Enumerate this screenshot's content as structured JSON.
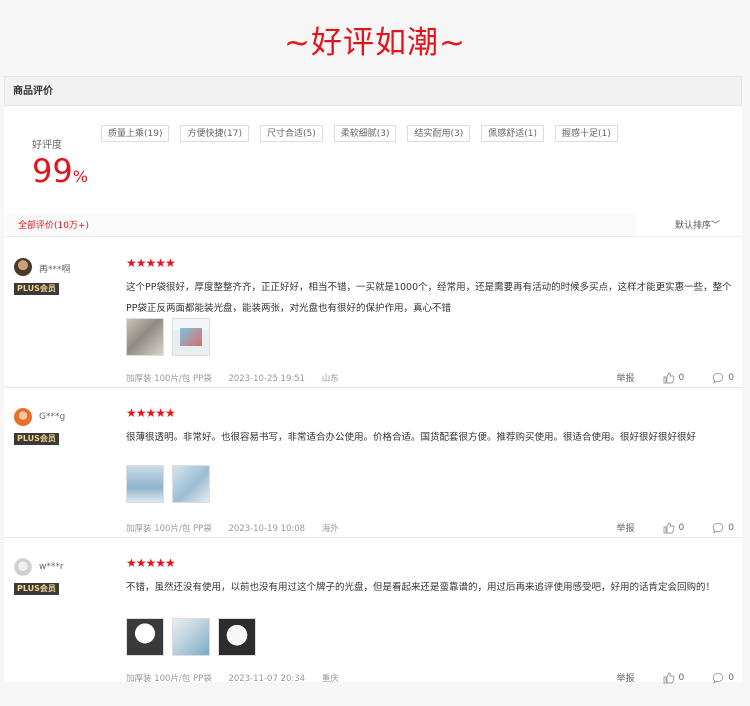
{
  "banner": {
    "title": "~好评如潮~"
  },
  "panel": {
    "title": "商品评价"
  },
  "rating": {
    "label": "好评度",
    "value": "99",
    "unit": "%"
  },
  "tags": [
    "质量上乘(19)",
    "方便快捷(17)",
    "尺寸合适(5)",
    "柔软细腻(3)",
    "结实耐用(3)",
    "佩感舒适(1)",
    "握感十足(1)"
  ],
  "filter": {
    "all_label": "全部评价(10万+)",
    "sort_label": "默认排序﹀"
  },
  "reviews": [
    {
      "user": "再***啊",
      "badge": "PLUS会员",
      "stars": "★★★★★",
      "content": "这个PP袋很好，厚度整整齐齐，正正好好，相当不错，一买就是1000个，经常用，还是需要再有活动的时候多买点，这样才能更实惠一些，整个PP袋正反两面都能装光盘，能装两张，对光盘也有很好的保护作用，真心不错",
      "product": "加厚装 100片/包 PP袋",
      "date": "2023-10-25 19:51",
      "location": "山东",
      "report": "举报",
      "likes": "0",
      "comments": "0"
    },
    {
      "user": "G***g",
      "badge": "PLUS会员",
      "stars": "★★★★★",
      "content": "很薄很透明。非常好。也很容易书写，非常适合办公使用。价格合适。国货配套很方便。推荐购买使用。很适合使用。很好很好很好很好",
      "product": "加厚装 100片/包 PP袋",
      "date": "2023-10-19 10:08",
      "location": "海外",
      "report": "举报",
      "likes": "0",
      "comments": "0"
    },
    {
      "user": "w***r",
      "badge": "PLUS会员",
      "stars": "★★★★★",
      "content": "不错，虽然还没有使用，以前也没有用过这个牌子的光盘，但是看起来还是蛮靠谱的，用过后再来追评使用感受吧，好用的话肯定会回购的！",
      "product": "加厚装 100片/包 PP袋",
      "date": "2023-11-07 20:34",
      "location": "重庆",
      "report": "举报",
      "likes": "0",
      "comments": "0"
    }
  ],
  "colors": {
    "accent": "#e4141c",
    "plus_bg": "#3a3a3a",
    "plus_text": "#f0d08a"
  },
  "icons": [
    "thumbs-up-icon",
    "comment-icon",
    "avatar-icon",
    "photo-thumbnail-icon"
  ]
}
